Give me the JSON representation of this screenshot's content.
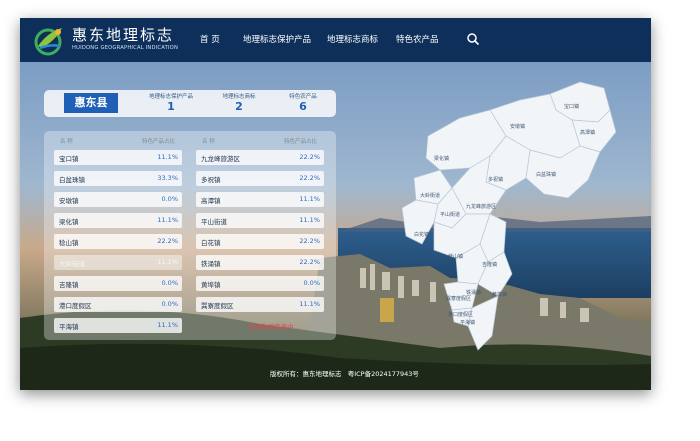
{
  "colors": {
    "header_bg": "#0d2f5a",
    "accent": "#1f5fb5",
    "value": "#2d6bc4",
    "loading": "#e04848"
  },
  "brand": {
    "title": "惠东地理标志",
    "subtitle": "HUIDONG GEOGRAPHICAL INDICATION",
    "logo_icon": "leaf-logo-icon"
  },
  "nav": [
    {
      "label": "首 页"
    },
    {
      "label": "地理标志保护产品"
    },
    {
      "label": "地理标志商标"
    },
    {
      "label": "特色农产品"
    }
  ],
  "search_icon": "search-icon",
  "summary": {
    "county": "惠东县",
    "stats": [
      {
        "label": "地理标志保护产品",
        "value": "1"
      },
      {
        "label": "地理标志商标",
        "value": "2"
      },
      {
        "label": "特色农产品",
        "value": "6"
      }
    ]
  },
  "table": {
    "headers": {
      "name": "名 称",
      "share": "特色产品占比"
    },
    "left_rows": [
      {
        "name": "宝口镇",
        "value": "11.1%"
      },
      {
        "name": "白盆珠镇",
        "value": "33.3%"
      },
      {
        "name": "安墩镇",
        "value": "0.0%"
      },
      {
        "name": "梁化镇",
        "value": "11.1%"
      },
      {
        "name": "稔山镇",
        "value": "22.2%"
      },
      {
        "name": "大岭街道",
        "value": "11.1%"
      },
      {
        "name": "吉隆镇",
        "value": "0.0%"
      },
      {
        "name": "港口度假区",
        "value": "0.0%"
      },
      {
        "name": "平海镇",
        "value": "11.1%"
      }
    ],
    "right_rows": [
      {
        "name": "九龙峰旅游区",
        "value": "22.2%"
      },
      {
        "name": "多祝镇",
        "value": "22.2%"
      },
      {
        "name": "高潭镇",
        "value": "11.1%"
      },
      {
        "name": "平山街道",
        "value": "11.1%"
      },
      {
        "name": "白花镇",
        "value": "22.2%"
      },
      {
        "name": "铁涌镇",
        "value": "22.2%"
      },
      {
        "name": "黄埠镇",
        "value": "0.0%"
      },
      {
        "name": "巽寮度假区",
        "value": "11.1%"
      }
    ],
    "loading_text": "系统数据完善中..."
  },
  "map_labels": [
    "宝口镇",
    "安墩镇",
    "高潭镇",
    "梁化镇",
    "多祝镇",
    "白盆珠镇",
    "大岭街道",
    "九龙峰旅游区",
    "平山街道",
    "白花镇",
    "稔山镇",
    "吉隆镇",
    "铁涌镇",
    "黄埠镇",
    "巽寮度假区",
    "港口度假区",
    "平海镇"
  ],
  "footer": {
    "copyright": "版权所有：惠东地理标志",
    "icp": "粤ICP备2024177943号"
  }
}
